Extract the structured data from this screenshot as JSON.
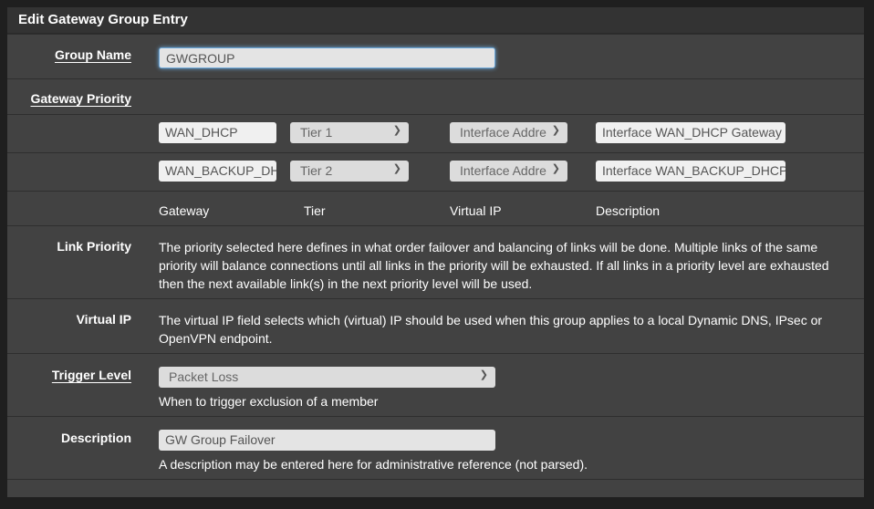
{
  "panel": {
    "title": "Edit Gateway Group Entry"
  },
  "group_name": {
    "label": "Group Name",
    "value": "GWGROUP"
  },
  "gateway_priority": {
    "label": "Gateway Priority",
    "rows": [
      {
        "gateway": "WAN_DHCP",
        "tier": "Tier 1",
        "virtual_ip": "Interface Addre",
        "description": "Interface WAN_DHCP Gateway"
      },
      {
        "gateway": "WAN_BACKUP_DH",
        "tier": "Tier 2",
        "virtual_ip": "Interface Addre",
        "description": "Interface WAN_BACKUP_DHCP"
      }
    ],
    "columns": {
      "gateway": "Gateway",
      "tier": "Tier",
      "virtual_ip": "Virtual IP",
      "description": "Description"
    }
  },
  "link_priority": {
    "label": "Link Priority",
    "text": "The priority selected here defines in what order failover and balancing of links will be done. Multiple links of the same priority will balance connections until all links in the priority will be exhausted. If all links in a priority level are exhausted then the next available link(s) in the next priority level will be used."
  },
  "virtual_ip": {
    "label": "Virtual IP",
    "text": "The virtual IP field selects which (virtual) IP should be used when this group applies to a local Dynamic DNS, IPsec or OpenVPN endpoint."
  },
  "trigger_level": {
    "label": "Trigger Level",
    "value": "Packet Loss",
    "help": "When to trigger exclusion of a member"
  },
  "description": {
    "label": "Description",
    "value": "GW Group Failover",
    "help": "A description may be entered here for administrative reference (not parsed)."
  }
}
